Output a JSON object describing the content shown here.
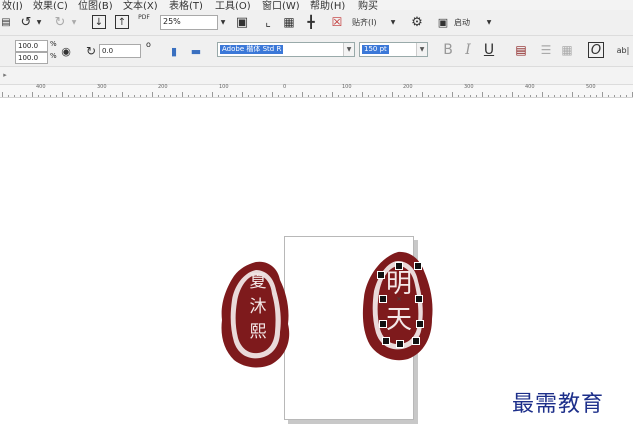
{
  "menu": {
    "items": [
      "效(J)",
      "效果(C)",
      "位图(B)",
      "文本(X)",
      "表格(T)",
      "工具(O)",
      "窗口(W)",
      "帮助(H)",
      "购买"
    ]
  },
  "toolbar1": {
    "zoom_value": "25%",
    "pdf_label": "PDF",
    "snap_label": "贴齐(I)",
    "launch_label": "启动"
  },
  "toolbar2": {
    "width_value": "100.0",
    "height_value": "100.0",
    "percent_unit": "%",
    "rotation_value": "0.0",
    "degree_symbol": "o",
    "font_name": "Adobe 楷体 Std R",
    "font_size": "150 pt",
    "bold_label": "B",
    "italic_label": "I",
    "underline_label": "U",
    "text_frame_label": "ab|"
  },
  "ruler": {
    "labels": [
      "400",
      "300",
      "200",
      "100",
      "0",
      "100",
      "200",
      "300",
      "400",
      "500"
    ]
  },
  "canvas": {
    "seal_left_text": [
      "夏",
      "沐",
      "熙"
    ],
    "seal_right_text": [
      "明",
      "天"
    ],
    "seal_color": "#7e1a1c"
  },
  "watermark": "最需教育"
}
